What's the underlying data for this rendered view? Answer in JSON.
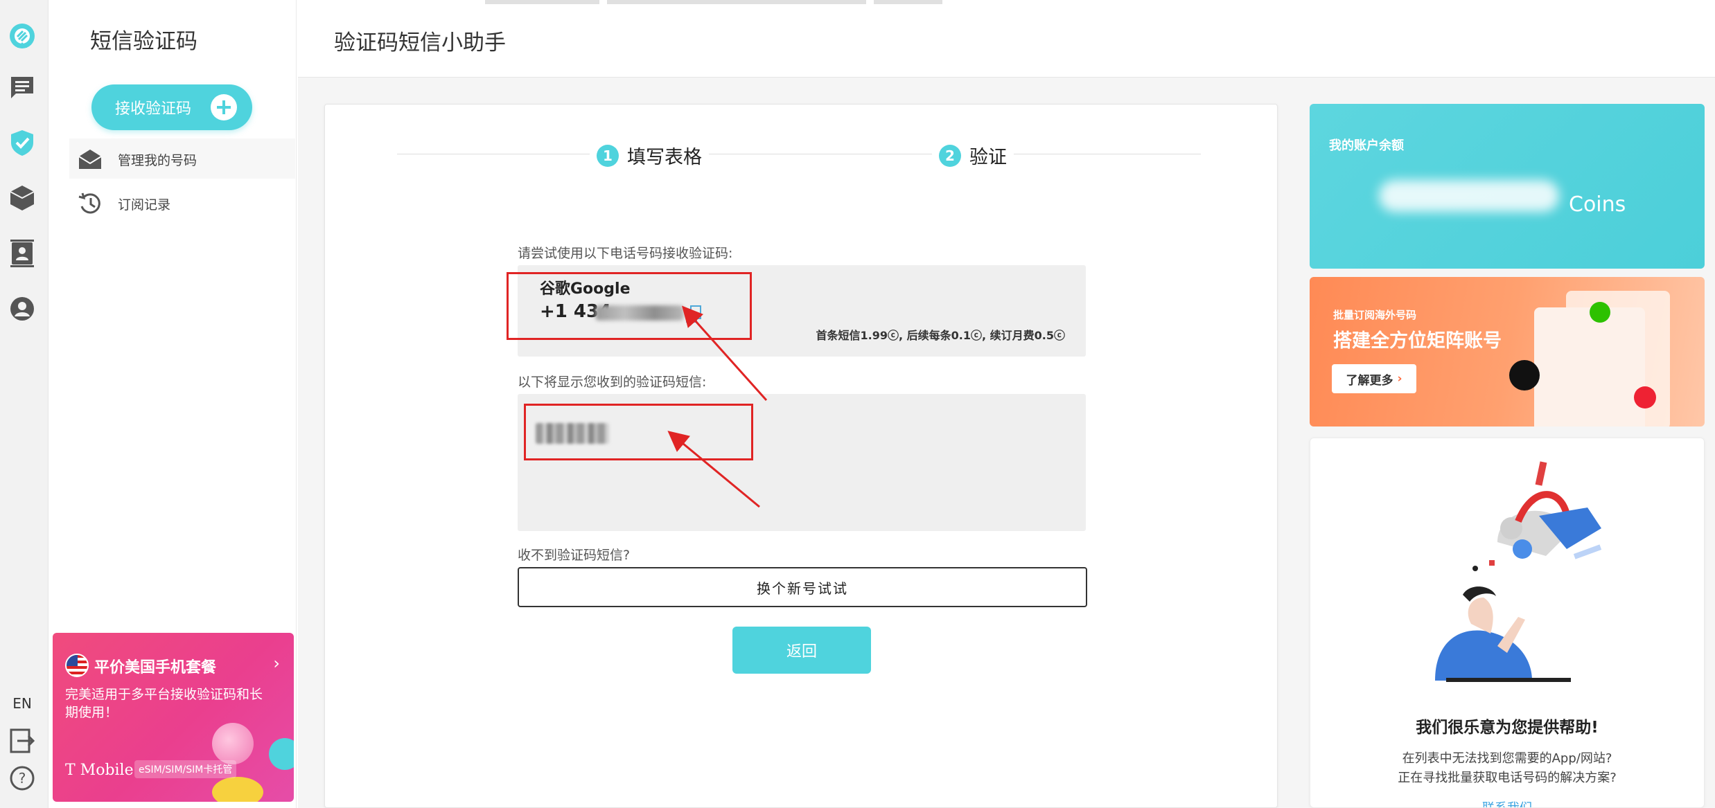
{
  "rail": {
    "items": [
      "logo",
      "messages",
      "verify-shield",
      "box",
      "contacts",
      "profile"
    ],
    "lang": "EN"
  },
  "sidebar": {
    "title": "短信验证码",
    "receive_button": "接收验证码",
    "items": [
      {
        "label": "管理我的号码",
        "icon": "envelope-open-icon"
      },
      {
        "label": "订阅记录",
        "icon": "history-icon"
      }
    ]
  },
  "promo": {
    "title": "平价美国手机套餐",
    "desc": "完美适用于多平台接收验证码和长期使用！",
    "brand": "T Mobile",
    "tag": "eSIM/SIM/SIM卡托管"
  },
  "header": {
    "title": "验证码短信小助手"
  },
  "steps": [
    {
      "num": "1",
      "label": "填写表格"
    },
    {
      "num": "2",
      "label": "验证"
    }
  ],
  "form": {
    "number_label": "请尝试使用以下电话号码接收验证码:",
    "app_name": "谷歌Google",
    "phone_prefix": "+1 434",
    "price": "首条短信1.99ⓒ, 后续每条0.1ⓒ, 续订月费0.5ⓒ",
    "sms_label": "以下将显示您收到的验证码短信:",
    "no_sms_label": "收不到验证码短信?",
    "new_number_button": "换个新号试试",
    "back_button": "返回"
  },
  "balance": {
    "title": "我的账户余额",
    "unit": "Coins"
  },
  "banner": {
    "sub": "批量订阅海外号码",
    "main": "搭建全方位矩阵账号",
    "more": "了解更多"
  },
  "help": {
    "title": "我们很乐意为您提供帮助!",
    "line1": "在列表中无法找到您需要的App/网站?",
    "line2": "正在寻找批量获取电话号码的解决方案?",
    "link": "联系我们"
  },
  "colors": {
    "accent": "#4fd3dd",
    "annotation": "#e02424",
    "promo": "#ea3f8e",
    "banner": "#ff8a55"
  }
}
